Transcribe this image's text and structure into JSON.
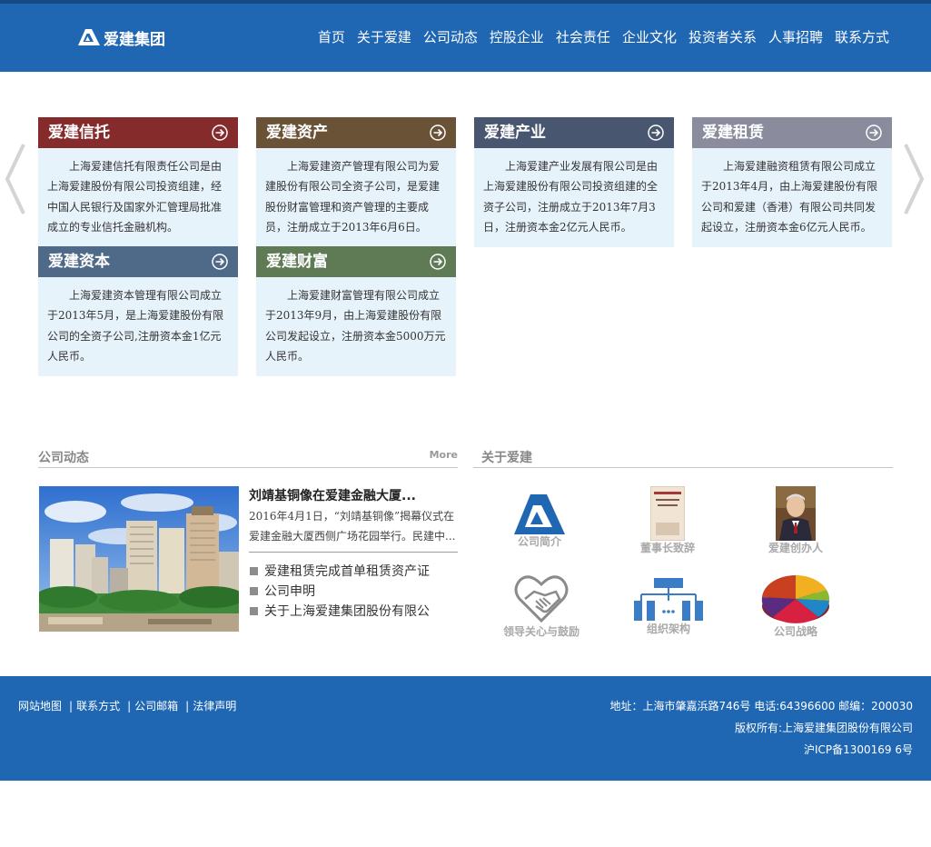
{
  "header": {
    "logo_text": "爱建集团",
    "nav": [
      "首页",
      "关于爱建",
      "公司动态",
      "控股企业",
      "社会责任",
      "企业文化",
      "投资者关系",
      "人事招聘",
      "联系方式"
    ]
  },
  "colors": {
    "header_bg": "#1f66b3",
    "card_trust": "#862b2c",
    "card_assets": "#6a5236",
    "card_industry": "#48566f",
    "card_leasing": "#8a8c9e",
    "card_capital": "#4f6a88",
    "card_wealth": "#5f7b56"
  },
  "cards": [
    {
      "title": "爱建信托",
      "text": "上海爱建信托有限责任公司是由上海爱建股份有限公司投资组建，经中国人民银行及国家外汇管理局批准成立的专业信托金融机构。"
    },
    {
      "title": "爱建资产",
      "text": "上海爱建资产管理有限公司为爱建股份有限公司全资子公司，是爱建股份财富管理和资产管理的主要成员，注册成立于2013年6月6日。"
    },
    {
      "title": "爱建产业",
      "text": "上海爱建产业发展有限公司是由上海爱建股份有限公司投资组建的全资子公司，注册成立于2013年7月3日，注册资本金2亿元人民币。"
    },
    {
      "title": "爱建租赁",
      "text": "上海爱建融资租赁有限公司成立于2013年4月，由上海爱建股份有限公司和爱建（香港）有限公司共同发起设立，注册资本金6亿元人民币。"
    },
    {
      "title": "爱建资本",
      "text": "上海爱建资本管理有限公司成立于2013年5月，是上海爱建股份有限公司的全资子公司,注册资本金1亿元人民币。"
    },
    {
      "title": "爱建财富",
      "text": "上海爱建财富管理有限公司成立于2013年9月，由上海爱建股份有限公司发起设立，注册资本金5000万元人民币。"
    }
  ],
  "news": {
    "title": "公司动态",
    "more": "More",
    "headline": "刘靖基铜像在爱建金融大厦...",
    "summary": "2016年4月1日，“刘靖基铜像”揭幕仪式在爱建金融大厦西侧广场花园举行。民建中...",
    "items": [
      "爱建租赁完成首单租赁资产证",
      "公司申明",
      "关于上海爱建集团股份有限公"
    ]
  },
  "about": {
    "title": "关于爱建",
    "items": [
      "公司简介",
      "董事长致辞",
      "爱建创办人",
      "领导关心与鼓励",
      "组织架构",
      "公司战略"
    ]
  },
  "footer": {
    "links": [
      "网站地图",
      "联系方式",
      "公司邮箱",
      "法律声明"
    ],
    "address": "地址：上海市肇嘉浜路746号 电话:64396600 邮编：200030",
    "copyright": "版权所有:上海爱建集团股份有限公司",
    "icp": "沪ICP备1300169 6号"
  }
}
